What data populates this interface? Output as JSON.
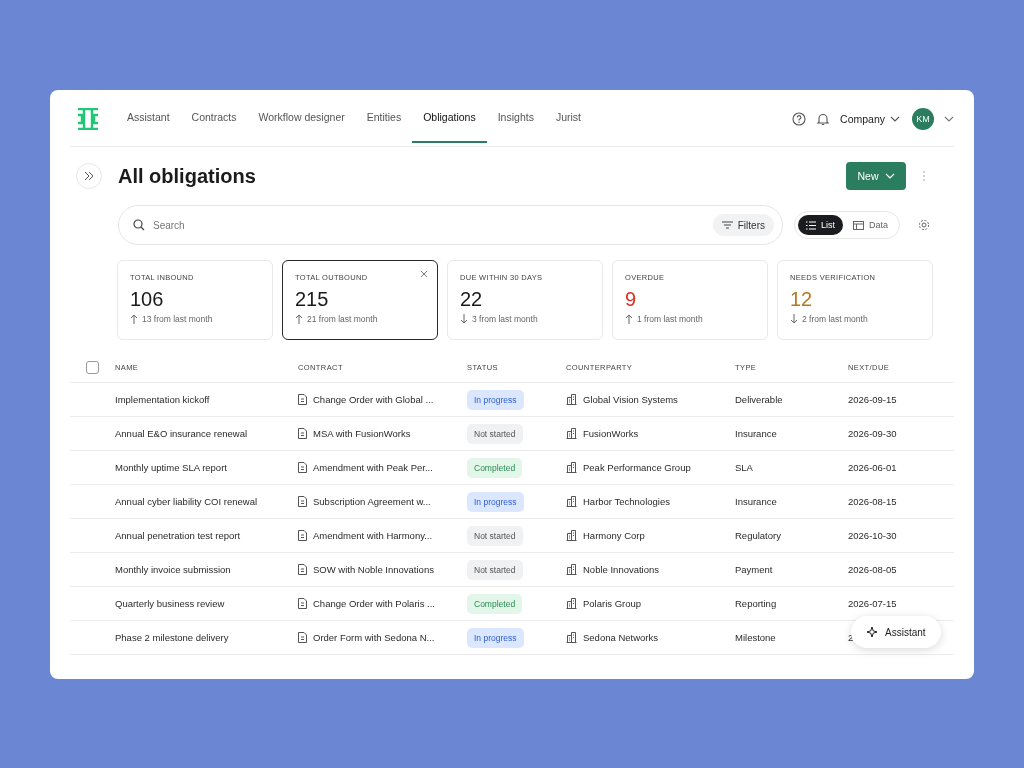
{
  "nav": {
    "items": [
      {
        "label": "Assistant",
        "selected": false
      },
      {
        "label": "Contracts",
        "selected": false
      },
      {
        "label": "Workflow designer",
        "selected": false
      },
      {
        "label": "Entities",
        "selected": false
      },
      {
        "label": "Obligations",
        "selected": true
      },
      {
        "label": "Insights",
        "selected": false
      },
      {
        "label": "Jurist",
        "selected": false
      }
    ],
    "company": "Company",
    "avatar": "KM"
  },
  "page": {
    "title": "All obligations",
    "new_button": "New"
  },
  "search": {
    "placeholder": "Search",
    "filters": "Filters"
  },
  "view_toggle": [
    {
      "label": "List",
      "selected": true
    },
    {
      "label": "Data",
      "selected": false
    }
  ],
  "stats": [
    {
      "label": "TOTAL INBOUND",
      "value": "106",
      "trend_up": true,
      "change": "13 from last month",
      "selected": false
    },
    {
      "label": "TOTAL OUTBOUND",
      "value": "215",
      "trend_up": true,
      "change": "21 from last month",
      "selected": true
    },
    {
      "label": "DUE WITHIN 30 DAYS",
      "value": "22",
      "trend_up": false,
      "change": "3 from last month",
      "selected": false
    },
    {
      "label": "OVERDUE",
      "value": "9",
      "color": "#d93025",
      "trend_up": true,
      "change": "1 from last month",
      "selected": false
    },
    {
      "label": "NEEDS VERIFICATION",
      "value": "12",
      "color": "#b7791f",
      "trend_up": false,
      "change": "2 from last month",
      "selected": false
    }
  ],
  "table": {
    "select_all_checked": false,
    "columns": [
      "NAME",
      "CONTRACT",
      "STATUS",
      "COUNTERPARTY",
      "TYPE",
      "NEXT/DUE"
    ],
    "rows": [
      {
        "name": "Implementation kickoff",
        "contract": "Change Order with Global ...",
        "status": "In progress",
        "kind": "progress",
        "counterparty": "Global Vision Systems",
        "type": "Deliverable",
        "next_due": "2026-09-15"
      },
      {
        "name": "Annual E&O insurance renewal",
        "contract": "MSA with FusionWorks",
        "status": "Not started",
        "kind": "pending",
        "counterparty": "FusionWorks",
        "type": "Insurance",
        "next_due": "2026-09-30"
      },
      {
        "name": "Monthly uptime SLA report",
        "contract": "Amendment with Peak Per...",
        "status": "Completed",
        "kind": "done",
        "counterparty": "Peak Performance Group",
        "type": "SLA",
        "next_due": "2026-06-01"
      },
      {
        "name": "Annual cyber liability COI renewal",
        "contract": "Subscription Agreement w...",
        "status": "In progress",
        "kind": "progress",
        "counterparty": "Harbor Technologies",
        "type": "Insurance",
        "next_due": "2026-08-15"
      },
      {
        "name": "Annual penetration test report",
        "contract": "Amendment with Harmony...",
        "status": "Not started",
        "kind": "pending",
        "counterparty": "Harmony Corp",
        "type": "Regulatory",
        "next_due": "2026-10-30"
      },
      {
        "name": "Monthly invoice submission",
        "contract": "SOW with Noble Innovations",
        "status": "Not started",
        "kind": "pending",
        "counterparty": "Noble Innovations",
        "type": "Payment",
        "next_due": "2026-08-05"
      },
      {
        "name": "Quarterly business review",
        "contract": "Change Order with Polaris ...",
        "status": "Completed",
        "kind": "done",
        "counterparty": "Polaris Group",
        "type": "Reporting",
        "next_due": "2026-07-15"
      },
      {
        "name": "Phase 2 milestone delivery",
        "contract": "Order Form with Sedona N...",
        "status": "In progress",
        "kind": "progress",
        "counterparty": "Sedona Networks",
        "type": "Milestone",
        "next_due": "2"
      }
    ]
  },
  "assistant_button": "Assistant"
}
